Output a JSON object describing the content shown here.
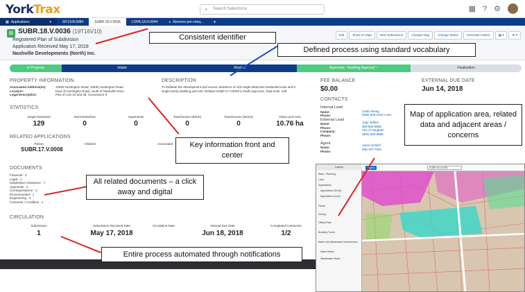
{
  "app": {
    "brand_primary": "York",
    "brand_accent": "Trax",
    "search_placeholder": "Search Salesforce"
  },
  "tabs": [
    {
      "label": "Applications"
    },
    {
      "label": "SP.19.B.0084"
    },
    {
      "label": "SUBR.18.V.0036"
    },
    {
      "label": "LOPA.18.N.0044"
    },
    {
      "label": "Remove pre-cheq..."
    }
  ],
  "record": {
    "id": "SUBR.18.V.0036",
    "alt_id": "(19T16V10)",
    "type": "Registered Plan of Subdivision",
    "received": "Application Received May 17, 2018",
    "applicant": "Nashville Developments (North) Inc."
  },
  "actions": [
    "Edit",
    "Show on Map",
    "New Submission",
    "Change Map",
    "Change Status",
    "Generate Letters",
    "▦ ▾",
    "⚙ ▾"
  ],
  "path": [
    "In Progress",
    "Intake",
    "Review",
    "Approvals : Awaiting Approval ✓",
    "Finalization"
  ],
  "property": {
    "heading": "PROPERTY INFORMATION",
    "address_label": "Associated Address(es):",
    "address_value": "10550 Huntington Road, 10530 Huntington Road",
    "location_label": "Location:",
    "location_value": "East of Huntington Road, south of Nashville Drive",
    "legal_label": "Legal Description:",
    "legal_value": "Part of Lots 24 and 25, Concession 9"
  },
  "description": {
    "heading": "DESCRIPTION",
    "text_1": "To facilitate the development and secure clearance of 125 single detached residential units and 9",
    "text_2": "single family dwelling part lots. Related SUBP.17.V.0008 is Draft Approved. Total units: 129"
  },
  "fee": {
    "heading": "FEE BALANCE",
    "value": "$0.00"
  },
  "due": {
    "heading": "EXTERNAL DUE DATE",
    "value": "Jun 14, 2018"
  },
  "contacts": {
    "heading": "CONTACTS",
    "internal_lead": "Internal Lead",
    "name_label": "Name:",
    "phone_label": "Phone:",
    "internal_name": "Justin Wong",
    "internal_phone": "(905) 830-4444 x 8xx",
    "external_lead": "External Lead",
    "company_label": "Company:",
    "ext_name": "Judy Jeffers",
    "ext_phone": "905-832-8585",
    "ext_company": "City of Vaughan",
    "ext_phone2": "(905) 832-8585",
    "agent": "Agent",
    "agent_name": "Aaron Schleif",
    "agent_phone": "905-787-7000"
  },
  "statistics": {
    "heading": "STATISTICS",
    "items": [
      {
        "label": "Single Detached",
        "value": "129"
      },
      {
        "label": "Semi-Detached",
        "value": "0"
      },
      {
        "label": "Apartments",
        "value": "0"
      },
      {
        "label": "Townhouses (Block)",
        "value": "0"
      },
      {
        "label": "Townhouses (Street)",
        "value": "0"
      },
      {
        "label": "Total Land Area",
        "value": "10.76 ha"
      }
    ]
  },
  "related": {
    "heading": "RELATED APPLICATIONS",
    "parent_label": "Parent",
    "parent_value": "SUBR.17.V.0008",
    "children_label": "Children",
    "associated_label": "Associated"
  },
  "documents": {
    "heading": "DOCUMENTS",
    "items": [
      "Financial - 3",
      "Legal - 1",
      "Subdivision Clearance - 7",
      "Approvals - 4",
      "Correspondence - 2",
      "Environmental - 1",
      "Engineering - 2",
      "Comment / Condition - 1"
    ]
  },
  "circulation": {
    "heading": "CIRCULATION",
    "items": [
      {
        "label": "Submission",
        "value": "1"
      },
      {
        "label": "Submission Received Date",
        "value": "May 17, 2018"
      },
      {
        "label": "Circulation Date",
        "value": ""
      },
      {
        "label": "Internal Due Date",
        "value": "Jun 18, 2018"
      },
      {
        "label": "Completed Comments",
        "value": "1/2"
      }
    ]
  },
  "map": {
    "panel_title": "Layers",
    "search_value": "SUBR.18.V.0036",
    "button_label": "Layers",
    "layers": [
      "Base - Planning",
      "Land",
      "Applications",
      "Applications (Point)",
      "Applications (Line)",
      "Parcel",
      "Zoning",
      "Official Plan",
      "Building Permit",
      "Water and Wastewater Infrastructure",
      "Water Mains",
      "Wastewater Mains"
    ]
  },
  "callouts": {
    "identifier": "Consistent identifier",
    "process": "Defined process using standard vocabulary",
    "key_info": "Key information front and center",
    "map": "Map of application area, related data and adjacent areas / concerns",
    "documents": "All related documents – a click away and digital",
    "automation": "Entire process automated through notifications"
  }
}
